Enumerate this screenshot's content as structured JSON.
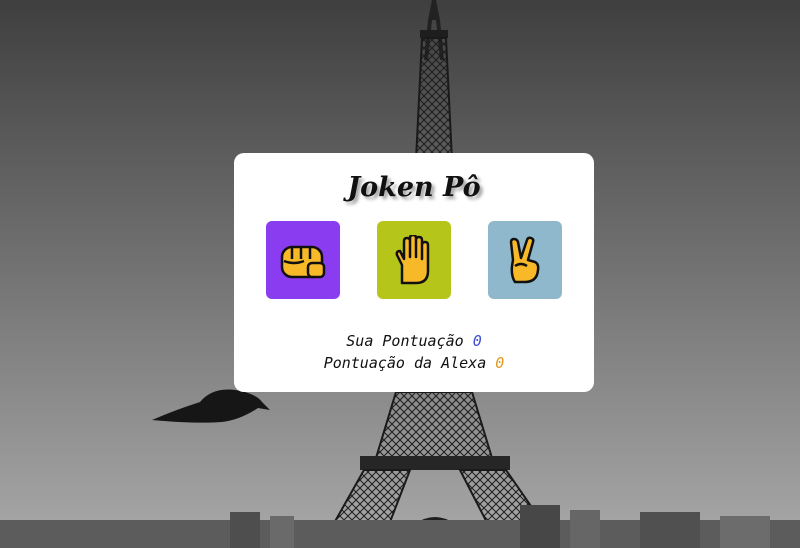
{
  "game": {
    "title": "Joken Pô",
    "choices": [
      {
        "name": "rock",
        "icon": "fist-icon",
        "color": "#8a3cf0"
      },
      {
        "name": "paper",
        "icon": "raised-hand-icon",
        "color": "#b5c51a"
      },
      {
        "name": "scissors",
        "icon": "victory-hand-icon",
        "color": "#90b8cc"
      }
    ],
    "scores": {
      "player_label": "Sua Pontuação",
      "player_value": "0",
      "player_color": "#3d4bd6",
      "alexa_label": "Pontuação da Alexa",
      "alexa_value": "0",
      "alexa_color": "#e29a1c"
    }
  },
  "background": {
    "subject": "eiffel-tower-grayscale-photo"
  }
}
